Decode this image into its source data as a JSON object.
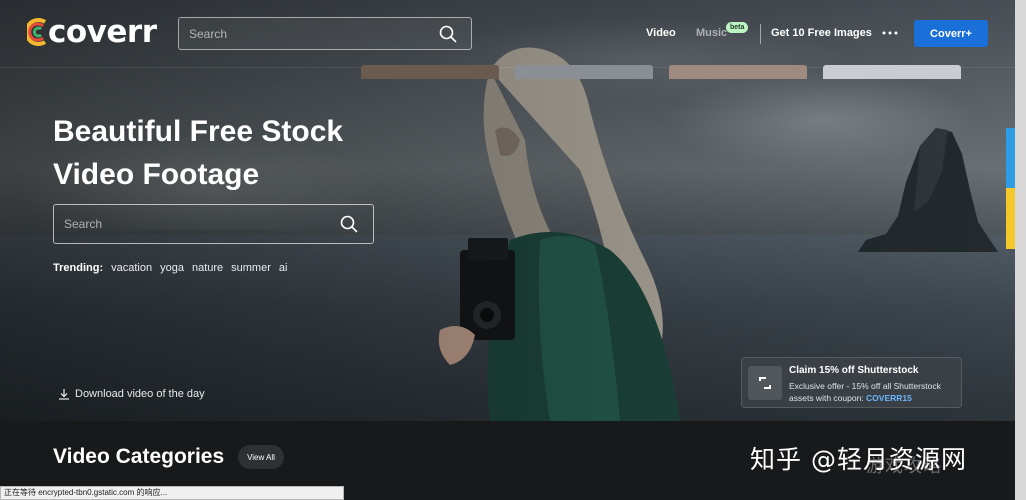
{
  "nav": {
    "logo_text": "coverr",
    "search_placeholder": "Search",
    "links": {
      "video": "Video",
      "music": "Music",
      "music_badge": "beta",
      "free_images": "Get 10 Free Images"
    },
    "cta_label": "Coverr+"
  },
  "hero": {
    "title_line1": "Beautiful Free Stock",
    "title_line2": "Video Footage",
    "search_placeholder": "Search",
    "trending_label": "Trending:",
    "trending_tags": [
      "vacation",
      "yoga",
      "nature",
      "summer",
      "ai"
    ],
    "download_label": "Download video of the day"
  },
  "promo": {
    "title": "Claim 15% off Shutterstock",
    "description": "Exclusive offer - 15% off all Shutterstock assets with coupon:",
    "code": "COVERR15"
  },
  "categories": {
    "title": "Video Categories",
    "view_all": "View All"
  },
  "watermark": {
    "text": "知乎 @轻月资源网",
    "sub": "游戏攻略"
  },
  "status_bar": {
    "text": "正在等待 encrypted-tbn0.gstatic.com 的响应..."
  },
  "colors": {
    "accent": "#1b6fd9",
    "beta_badge": "#bdf5c3",
    "coupon_code": "#6bb6ff",
    "page_bg": "#16181a",
    "edge_blue": "#2f9ce6",
    "edge_yellow": "#f3c82c"
  }
}
